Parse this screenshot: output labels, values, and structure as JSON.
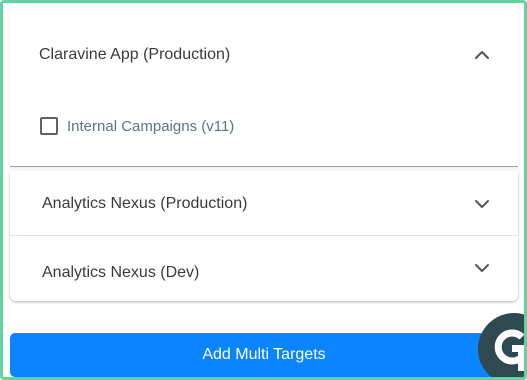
{
  "panels": [
    {
      "title": "Claravine App (Production)",
      "expanded": true,
      "chevron_icon": "chevron-up-icon",
      "options": [
        {
          "label": "Internal Campaigns (v11)",
          "checked": false
        }
      ]
    },
    {
      "title": "Analytics Nexus (Production)",
      "expanded": false,
      "chevron_icon": "chevron-down-icon"
    },
    {
      "title": "Analytics Nexus (Dev)",
      "expanded": false,
      "chevron_icon": "chevron-down-icon"
    }
  ],
  "actions": {
    "add_label": "Add Multi Targets"
  },
  "colors": {
    "frame_border": "#5fd3a0",
    "primary_button": "#0a84ff",
    "chat_widget": "#2e4a50",
    "option_label": "#5a7583"
  },
  "chat_widget_icon": "chat-logo-icon"
}
